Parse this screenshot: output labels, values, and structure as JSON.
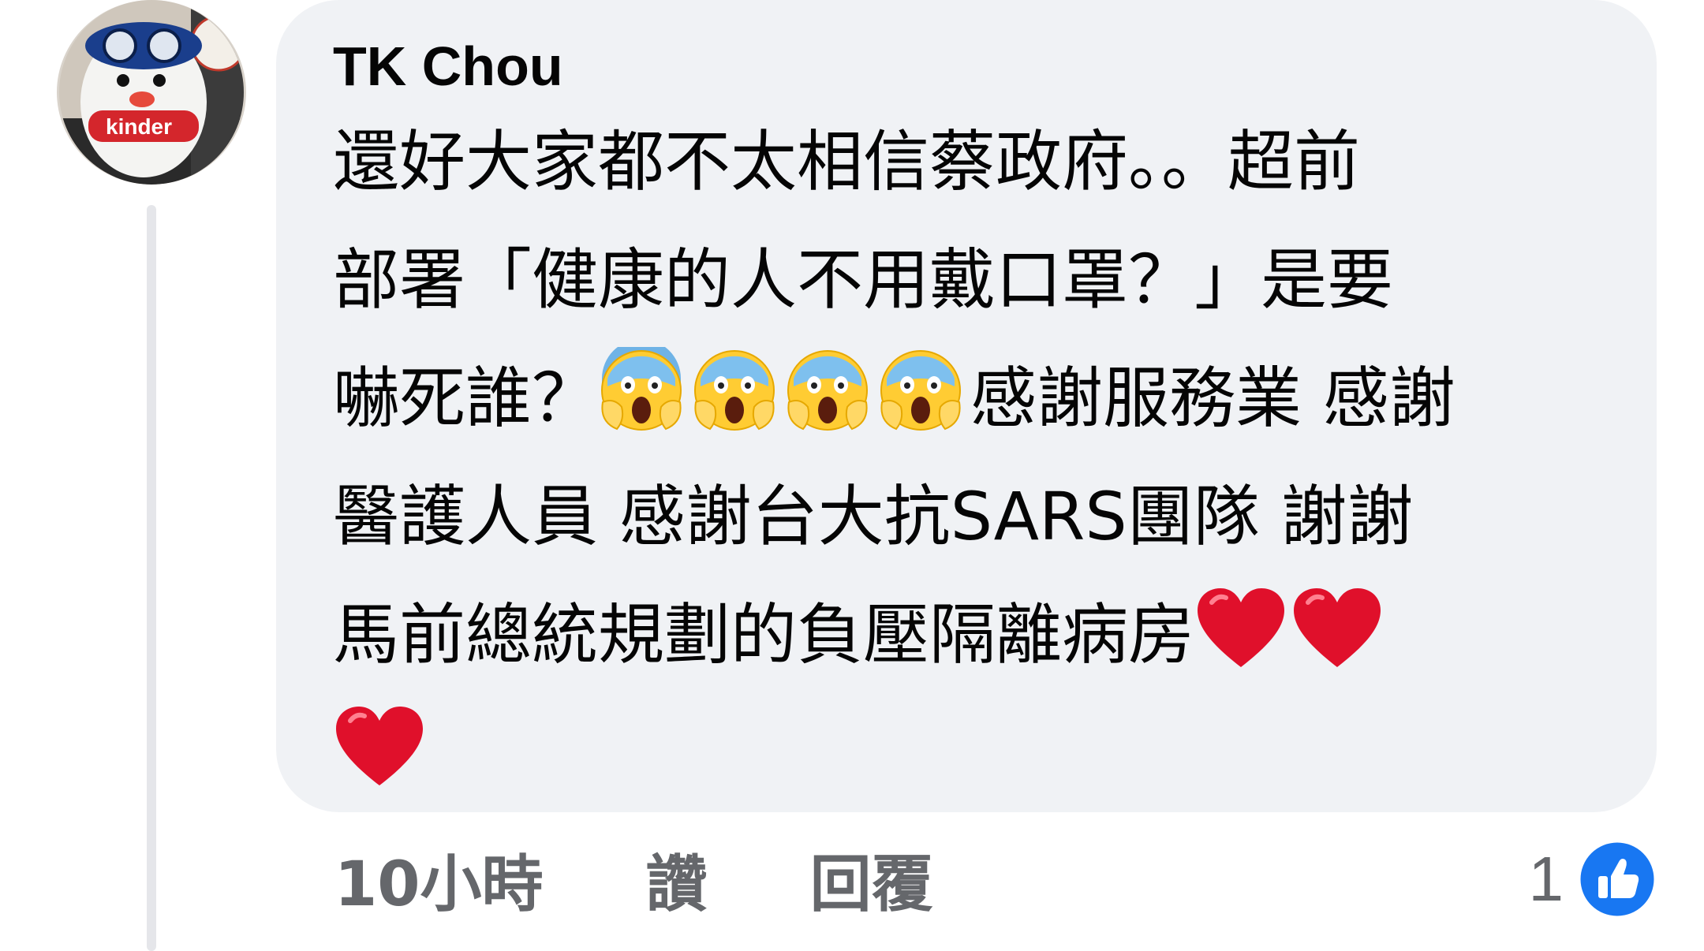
{
  "comment": {
    "author": "TK Chou",
    "text_lines": [
      "還好大家都不太相信蔡政府。。超前",
      "部署「健康的人不用戴口罩？」是要",
      "嚇死誰？",
      "感謝服務業 感謝",
      "醫護人員 感謝台大抗SARS團隊 謝謝",
      "馬前總統規劃的負壓隔離病房"
    ],
    "emoji_icons": [
      "face-screaming-in-fear-icon",
      "red-heart-icon"
    ],
    "time": "10小時",
    "like_label": "讚",
    "reply_label": "回覆",
    "reaction_count": "1"
  },
  "colors": {
    "bubble": "#f0f2f5",
    "text": "#050505",
    "secondary": "#65676b",
    "like_blue": "#1877f2",
    "heart_red": "#e0102b"
  }
}
